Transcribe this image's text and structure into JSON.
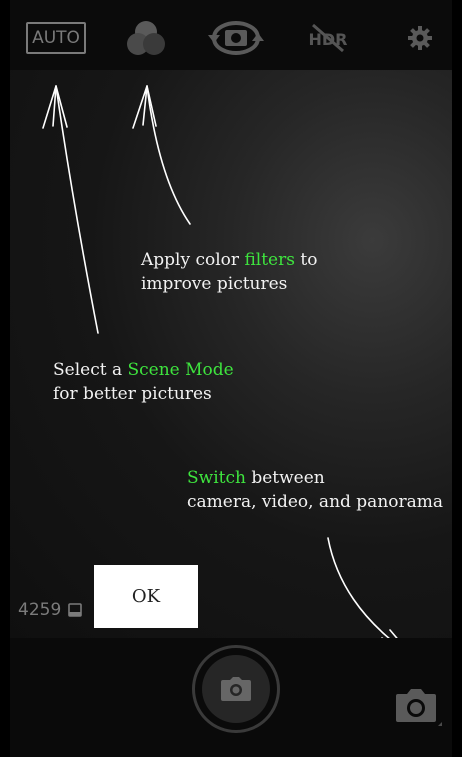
{
  "topbar": {
    "scene_mode_label": "AUTO",
    "icons": {
      "filters": "color-filters-icon",
      "switch_camera": "switch-camera-icon",
      "hdr": "hdr-off-icon",
      "settings": "gear-icon"
    }
  },
  "hints": {
    "filters": {
      "pre": "Apply color ",
      "highlight": "filters",
      "post": " to",
      "line2": "improve pictures"
    },
    "scene": {
      "pre": "Select a ",
      "highlight": "Scene Mode",
      "post": "",
      "line2": "for better pictures"
    },
    "switch": {
      "pre": "",
      "highlight": "Switch",
      "post": " between",
      "line2": "camera, video, and panorama"
    }
  },
  "ok_label": "OK",
  "photo_count": "4259",
  "colors": {
    "highlight": "#3ee43e",
    "background": "#000000",
    "text": "#f2f2f2"
  }
}
